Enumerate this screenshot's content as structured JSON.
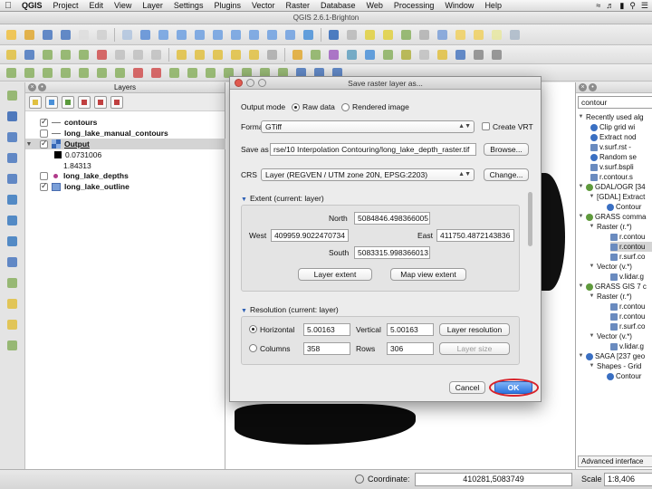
{
  "menubar": {
    "app": "QGIS",
    "items": [
      "Project",
      "Edit",
      "View",
      "Layer",
      "Settings",
      "Plugins",
      "Vector",
      "Raster",
      "Database",
      "Web",
      "Processing",
      "Window",
      "Help"
    ]
  },
  "window_title": "QGIS 2.6.1-Brighton",
  "layers_panel": {
    "title": "Layers",
    "layers": [
      {
        "name": "contours",
        "checked": true,
        "bold": true
      },
      {
        "name": "long_lake_manual_contours",
        "checked": false,
        "bold": true
      },
      {
        "name": "Output",
        "checked": true,
        "bold": true,
        "selected": true
      },
      {
        "name": "long_lake_depths",
        "checked": false,
        "bold": true
      },
      {
        "name": "long_lake_outline",
        "checked": true,
        "bold": true
      }
    ],
    "legend_min": "0.0731006",
    "legend_max": "1.84313"
  },
  "processing": {
    "search_value": "contour",
    "rows": [
      "Recently used alg",
      "Clip grid wi",
      "Extract nod",
      "v.surf.rst - ",
      "Random se",
      "v.surf.bspli",
      "r.contour.s",
      "GDAL/OGR [34",
      "[GDAL] Extract",
      "Contour",
      "GRASS comma",
      "Raster (r.*)",
      "r.contou",
      "r.contou",
      "r.surf.co",
      "Vector (v.*)",
      "v.lidar.g",
      "GRASS GIS 7 c",
      "Raster (r.*)",
      "r.contou",
      "r.contou",
      "r.surf.co",
      "Vector (v.*)",
      "v.lidar.g",
      "SAGA [237 geo",
      "Shapes - Grid",
      "Contour"
    ],
    "advanced_button": "Advanced interface"
  },
  "dialog": {
    "title": "Save raster layer as...",
    "output_mode_label": "Output mode",
    "raw_data": "Raw data",
    "rendered_image": "Rendered image",
    "format_label": "Format",
    "format_value": "GTiff",
    "create_vrt": "Create VRT",
    "save_as_label": "Save as",
    "save_as_value": "rse/10 Interpolation Contouring/long_lake_depth_raster.tif",
    "browse": "Browse...",
    "crs_label": "CRS",
    "crs_value": "Layer (REGVEN / UTM zone 20N, EPSG:2203)",
    "change": "Change...",
    "extent_header": "Extent (current: layer)",
    "north_label": "North",
    "north_value": "5084846.498366005",
    "west_label": "West",
    "west_value": "409959.9022470734",
    "east_label": "East",
    "east_value": "411750.4872143836",
    "south_label": "South",
    "south_value": "5083315.998366013",
    "layer_extent": "Layer extent",
    "map_view_extent": "Map view extent",
    "resolution_header": "Resolution (current: layer)",
    "horizontal_label": "Horizontal",
    "horizontal_value": "5.00163",
    "vertical_label": "Vertical",
    "vertical_value": "5.00163",
    "layer_resolution": "Layer resolution",
    "columns_label": "Columns",
    "columns_value": "358",
    "rows_label": "Rows",
    "rows_value": "306",
    "layer_size": "Layer size",
    "cancel": "Cancel",
    "ok": "OK"
  },
  "statusbar": {
    "coordinate_label": "Coordinate:",
    "coordinate_value": "410281,5083749",
    "scale_label": "Scale",
    "scale_value": "1:8,406"
  }
}
